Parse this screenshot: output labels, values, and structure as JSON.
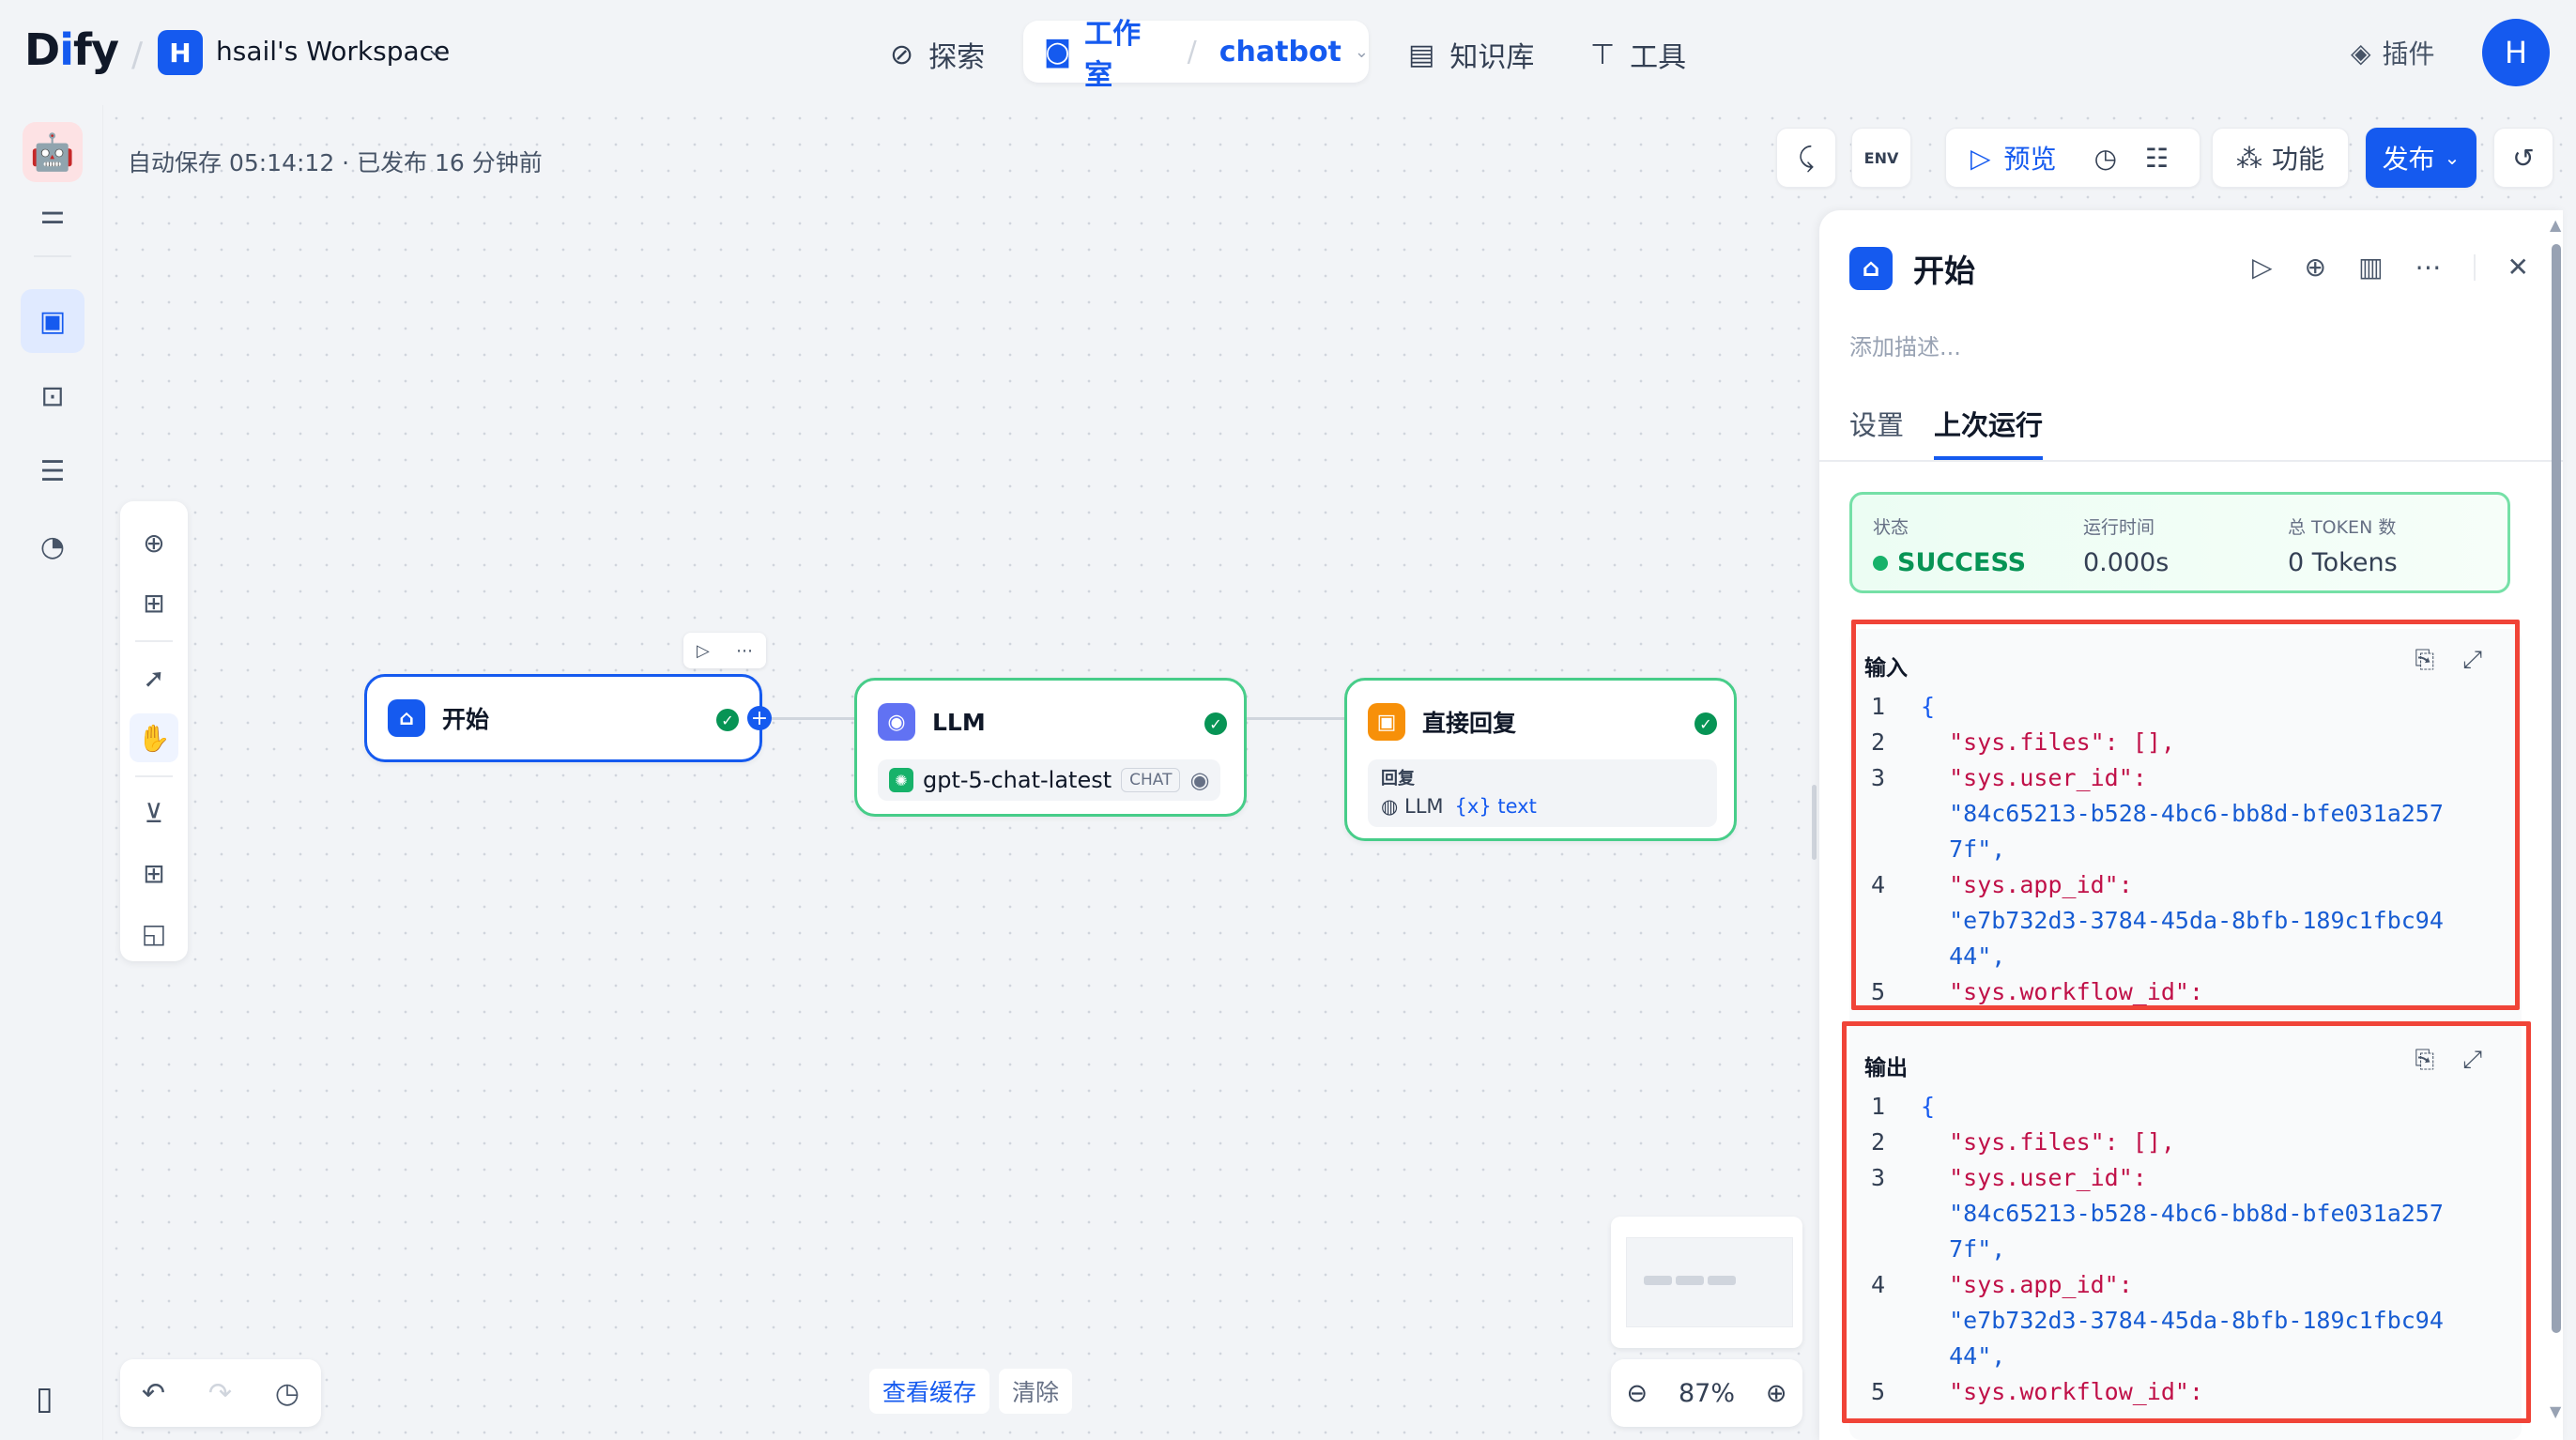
{
  "brand": {
    "logo_prefix": "D",
    "logo_i": "i",
    "logo_suffix": "fy"
  },
  "workspace": {
    "avatar": "H",
    "name": "hsail's Workspace"
  },
  "nav": {
    "explore": "探索",
    "studio": "工作室",
    "app_name": "chatbot",
    "knowledge": "知识库",
    "tools": "工具",
    "plugins": "插件",
    "user_avatar": "H"
  },
  "toolbar": {
    "save_info": "自动保存 05:14:12 · 已发布 16 分钟前",
    "env_label": "ENV",
    "preview": "预览",
    "features": "功能",
    "publish": "发布"
  },
  "nodes": {
    "start": {
      "title": "开始"
    },
    "llm": {
      "title": "LLM",
      "model": "gpt-5-chat-latest",
      "mode_tag": "CHAT"
    },
    "answer": {
      "title": "直接回复",
      "reply_label": "回复",
      "source_node": "LLM",
      "var_name": "text"
    }
  },
  "bottom": {
    "view_cache": "查看缓存",
    "clear": "清除",
    "zoom": "87%"
  },
  "panel": {
    "title": "开始",
    "description_placeholder": "添加描述...",
    "tabs": [
      "设置",
      "上次运行"
    ],
    "active_tab": 1,
    "status": {
      "status_label": "状态",
      "status_value": "SUCCESS",
      "time_label": "运行时间",
      "time_value": "0.000s",
      "tokens_label": "总 TOKEN 数",
      "tokens_value": "0 Tokens"
    },
    "input": {
      "label": "输入",
      "lines": [
        {
          "n": "1",
          "t": "{"
        },
        {
          "n": "2",
          "t": "  \"sys.files\": [],"
        },
        {
          "n": "3",
          "t": "  \"sys.user_id\":"
        },
        {
          "n": "",
          "t": "  \"84c65213-b528-4bc6-bb8d-bfe031a257"
        },
        {
          "n": "",
          "t": "  7f\","
        },
        {
          "n": "4",
          "t": "  \"sys.app_id\":"
        },
        {
          "n": "",
          "t": "  \"e7b732d3-3784-45da-8bfb-189c1fbc94"
        },
        {
          "n": "",
          "t": "  44\","
        },
        {
          "n": "5",
          "t": "  \"sys.workflow_id\":"
        }
      ]
    },
    "output": {
      "label": "输出",
      "lines": [
        {
          "n": "1",
          "t": "{"
        },
        {
          "n": "2",
          "t": "  \"sys.files\": [],"
        },
        {
          "n": "3",
          "t": "  \"sys.user_id\":"
        },
        {
          "n": "",
          "t": "  \"84c65213-b528-4bc6-bb8d-bfe031a257"
        },
        {
          "n": "",
          "t": "  7f\","
        },
        {
          "n": "4",
          "t": "  \"sys.app_id\":"
        },
        {
          "n": "",
          "t": "  \"e7b732d3-3784-45da-8bfb-189c1fbc94"
        },
        {
          "n": "",
          "t": "  44\","
        },
        {
          "n": "5",
          "t": "  \"sys.workflow_id\":"
        }
      ]
    }
  },
  "colors": {
    "accent": "#155aef",
    "success": "#079455",
    "node_border": "#47cd89",
    "highlight": "#f04438"
  }
}
